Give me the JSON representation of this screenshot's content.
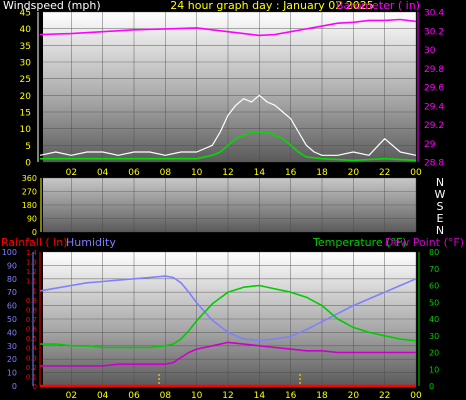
{
  "colors": {
    "background": "#000000",
    "wind_speed": "#ffffff",
    "wind_avg": "#00dd00",
    "barometer": "#ff00ff",
    "rainfall": "#ff0000",
    "humidity": "#7f7fff",
    "temperature": "#00cc00",
    "dew_point": "#cc00cc",
    "grid": "#4a4a4a",
    "tick_label": "#ffff00",
    "marker": "#ffcc00"
  },
  "chart_data": [
    {
      "id": "wind-baro",
      "type": "line",
      "title": "24 hour graph day : January 02 2025",
      "left_axis_label": "Windspeed (mph)",
      "right_axis_label": "Barometer ( in)",
      "x_ticks": [
        "02",
        "04",
        "06",
        "08",
        "10",
        "12",
        "14",
        "16",
        "18",
        "20",
        "22",
        "00"
      ],
      "x_range": [
        0,
        24
      ],
      "left_range": [
        0,
        45
      ],
      "left_ticks": [
        "0",
        "5",
        "10",
        "15",
        "20",
        "25",
        "30",
        "35",
        "40",
        "45"
      ],
      "right_range": [
        28.8,
        30.4
      ],
      "right_ticks": [
        "28.8",
        "29",
        "29.2",
        "29.4",
        "29.6",
        "29.8",
        "30",
        "30.2",
        "30.4"
      ],
      "grid": true,
      "series": [
        {
          "name": "Windspeed",
          "axis": "left",
          "style": "gust",
          "x": [
            0,
            1,
            2,
            3,
            4,
            5,
            6,
            7,
            8,
            9,
            10,
            11,
            11.5,
            12,
            12.5,
            13,
            13.5,
            14,
            14.5,
            15,
            15.5,
            16,
            16.5,
            17,
            17.5,
            18,
            19,
            20,
            21,
            22,
            23,
            24
          ],
          "y": [
            2,
            3,
            2,
            3,
            3,
            2,
            3,
            3,
            2,
            3,
            3,
            5,
            9,
            14,
            17,
            19,
            18,
            20,
            18,
            17,
            15,
            13,
            9,
            5,
            3,
            2,
            2,
            3,
            2,
            7,
            3,
            2
          ]
        },
        {
          "name": "Average wind",
          "axis": "left",
          "style": "line",
          "x": [
            0,
            2,
            4,
            6,
            8,
            10,
            11,
            11.5,
            12,
            12.5,
            13,
            13.5,
            14,
            14.5,
            15,
            15.5,
            16,
            16.5,
            17,
            18,
            20,
            22,
            24
          ],
          "y": [
            1,
            1,
            1,
            1,
            1,
            1,
            2,
            3,
            5,
            7,
            8,
            9,
            9,
            9,
            8,
            7,
            5,
            3,
            1.5,
            1,
            0.5,
            1,
            0.5
          ]
        },
        {
          "name": "Barometer",
          "axis": "right",
          "style": "line",
          "x": [
            0,
            2,
            4,
            6,
            8,
            10,
            11,
            12,
            13,
            14,
            15,
            16,
            17,
            18,
            19,
            20,
            21,
            22,
            23,
            24
          ],
          "y": [
            30.16,
            30.17,
            30.19,
            30.21,
            30.22,
            30.23,
            30.21,
            30.19,
            30.17,
            30.15,
            30.16,
            30.19,
            30.22,
            30.25,
            30.28,
            30.29,
            30.31,
            30.31,
            30.32,
            30.3
          ]
        }
      ]
    },
    {
      "id": "wind-dir",
      "type": "scatter",
      "x_ticks": [
        "02",
        "04",
        "06",
        "08",
        "10",
        "12",
        "14",
        "16",
        "18",
        "20",
        "22",
        "00"
      ],
      "x_range": [
        0,
        24
      ],
      "left_range": [
        0,
        360
      ],
      "left_ticks": [
        "0",
        "90",
        "180",
        "270",
        "360"
      ],
      "right_labels": [
        "N",
        "W",
        "S",
        "E",
        "N"
      ],
      "grid": true,
      "series": []
    },
    {
      "id": "rain-hum-temp",
      "type": "line",
      "labels": {
        "rainfall": "Rainfall ( in)",
        "humidity": "Humidity",
        "temperature": "Temperature (°F)",
        "dew_point": "Dew Point (°F)"
      },
      "x_ticks": [
        "02",
        "04",
        "06",
        "08",
        "10",
        "12",
        "14",
        "16",
        "18",
        "20",
        "22",
        "00"
      ],
      "x_range": [
        0,
        24
      ],
      "humidity_range": [
        0,
        100
      ],
      "humidity_ticks": [
        "0",
        "10",
        "20",
        "30",
        "40",
        "50",
        "60",
        "70",
        "80",
        "90",
        "100"
      ],
      "rain_range": [
        0,
        1.4
      ],
      "rain_ticks": [
        "0",
        "0.1",
        "0.2",
        "0.3",
        "0.4",
        "0.5",
        "0.6",
        "0.7",
        "0.8",
        "0.9",
        "1",
        "1.1",
        "1.2",
        "1.3",
        "1.4"
      ],
      "temp_range": [
        0,
        80
      ],
      "temp_ticks": [
        "0",
        "10",
        "20",
        "30",
        "40",
        "50",
        "60",
        "70",
        "80"
      ],
      "grid": true,
      "markers_x": [
        7.6,
        16.6
      ],
      "series": [
        {
          "name": "Humidity",
          "axis": "humidity",
          "x": [
            0,
            1,
            2,
            3,
            4,
            5,
            6,
            7,
            8,
            8.5,
            9,
            9.5,
            10,
            11,
            12,
            13,
            14,
            15,
            16,
            17,
            18,
            19,
            20,
            21,
            22,
            23,
            24
          ],
          "y": [
            71,
            73,
            75,
            77,
            78,
            79,
            80,
            81,
            82,
            81,
            77,
            70,
            62,
            49,
            40,
            35,
            34,
            35,
            37,
            42,
            48,
            54,
            60,
            65,
            70,
            75,
            80
          ]
        },
        {
          "name": "Rainfall",
          "axis": "rain",
          "x": [
            0,
            24
          ],
          "y": [
            0,
            0
          ]
        },
        {
          "name": "Temperature",
          "axis": "temp",
          "x": [
            0,
            1,
            2,
            3,
            4,
            5,
            6,
            7,
            8,
            8.5,
            9,
            9.5,
            10,
            11,
            12,
            13,
            14,
            15,
            16,
            17,
            18,
            19,
            20,
            21,
            22,
            23,
            24
          ],
          "y": [
            25,
            25,
            24,
            24,
            23,
            23,
            23,
            23,
            24,
            25,
            28,
            33,
            39,
            49,
            56,
            59,
            60,
            58,
            56,
            53,
            48,
            40,
            35,
            32,
            30,
            28,
            27
          ]
        },
        {
          "name": "Dew Point",
          "axis": "temp",
          "x": [
            0,
            1,
            2,
            3,
            4,
            5,
            6,
            7,
            8,
            8.5,
            9,
            9.5,
            10,
            11,
            12,
            13,
            14,
            15,
            16,
            17,
            18,
            19,
            20,
            21,
            22,
            23,
            24
          ],
          "y": [
            12,
            12,
            12,
            12,
            12,
            13,
            13,
            13,
            13,
            14,
            17,
            20,
            22,
            24,
            26,
            25,
            24,
            23,
            22,
            21,
            21,
            20,
            20,
            20,
            20,
            20,
            20
          ]
        }
      ]
    }
  ]
}
